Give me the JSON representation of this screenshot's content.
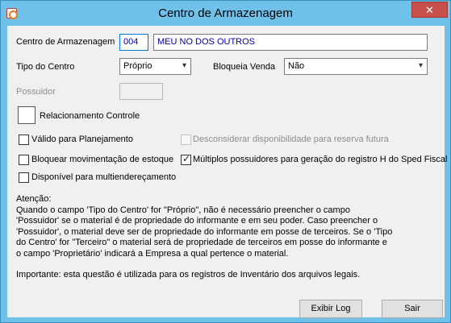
{
  "window": {
    "title": "Centro de Armazenagem",
    "close_glyph": "✕"
  },
  "form": {
    "centro_label": "Centro de Armazenagem",
    "centro_code": "004",
    "centro_name": "MEU NO DOS OUTROS",
    "tipo_label": "Tipo do Centro",
    "tipo_value": "Próprio",
    "bloqueia_label": "Bloqueia Venda",
    "bloqueia_value": "Não",
    "possuidor_label": "Possuidor",
    "possuidor_value": "",
    "relacionamento_label": "Relacionamento Controle"
  },
  "checkboxes": {
    "valido_label": "Válido para Planejamento",
    "valido_checked": false,
    "desconsiderar_label": "Desconsiderar disponibilidade para reserva futura",
    "desconsiderar_checked": false,
    "bloquear_label": "Bloquear movimentação de estoque",
    "bloquear_checked": false,
    "multiplos_label": "Múltiplos possuidores para geração do registro H do Sped Fiscal",
    "multiplos_checked": true,
    "disponivel_label": "Disponível para multiendereçamento",
    "disponivel_checked": false
  },
  "info": {
    "lines": [
      "Atenção:",
      "Quando o campo 'Tipo do Centro' for \"Próprio\", não é necessário preencher o campo",
      "'Possuidor' se o material é de propriedade do informante e em seu poder. Caso preencher o",
      "'Possuidor', o material deve ser de propriedade do informante em posse de terceiros. Se o 'Tipo",
      "do Centro' for \"Terceiro\" o material será de propriedade de terceiros em posse do informante e",
      "o campo 'Proprietário' indicará a Empresa a qual pertence o material."
    ],
    "note": "Importante: esta questão é utilizada para os registros de Inventário dos arquivos legais."
  },
  "buttons": {
    "exibir_log": "Exibir Log",
    "sair": "Sair"
  },
  "colors": {
    "title_bar": "#6fc1ea",
    "close_button": "#c7504b",
    "client_bg": "#f0f0f0",
    "text_value": "#0000a8"
  }
}
